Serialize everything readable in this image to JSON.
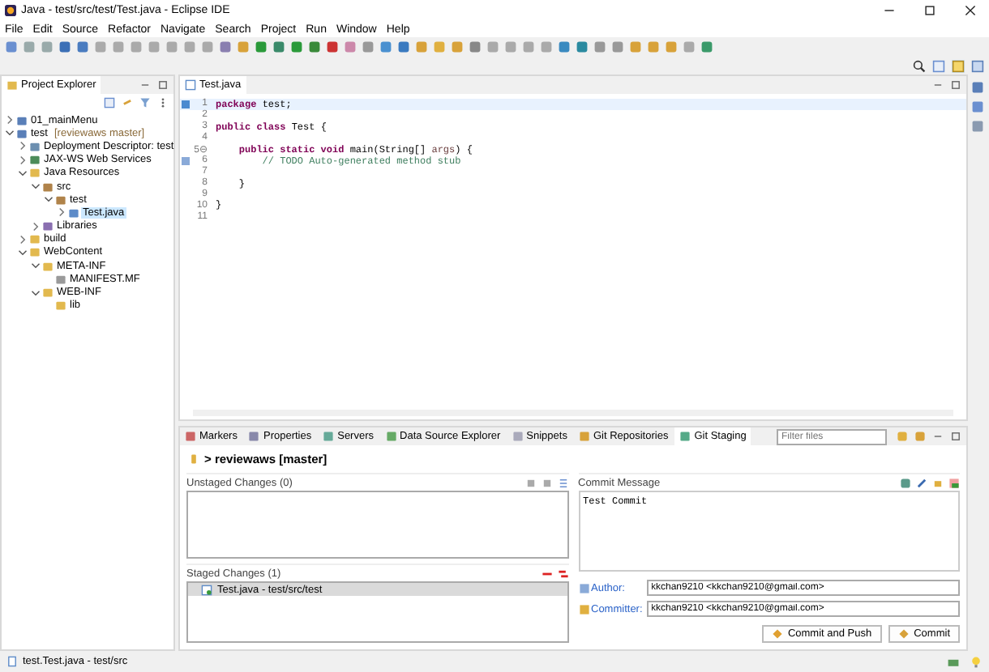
{
  "window": {
    "title": "Java - test/src/test/Test.java - Eclipse IDE"
  },
  "menu": [
    "File",
    "Edit",
    "Source",
    "Refactor",
    "Navigate",
    "Search",
    "Project",
    "Run",
    "Window",
    "Help"
  ],
  "project_explorer": {
    "tab": {
      "label": "Project Explorer",
      "selected": true
    },
    "tree": [
      {
        "label": "01_mainMenu",
        "expanded": false,
        "kind": "project"
      },
      {
        "label": "test",
        "decoration": "[reviewaws master]",
        "expanded": true,
        "kind": "project",
        "children": [
          {
            "label": "Deployment Descriptor: test",
            "expanded": false,
            "kind": "descriptor"
          },
          {
            "label": "JAX-WS Web Services",
            "expanded": false,
            "kind": "services"
          },
          {
            "label": "Java Resources",
            "expanded": true,
            "kind": "folder",
            "children": [
              {
                "label": "src",
                "expanded": true,
                "kind": "package",
                "children": [
                  {
                    "label": "test",
                    "expanded": true,
                    "kind": "package",
                    "children": [
                      {
                        "label": "Test.java",
                        "expanded": false,
                        "kind": "java",
                        "selected": true
                      }
                    ]
                  }
                ]
              },
              {
                "label": "Libraries",
                "expanded": false,
                "kind": "library"
              }
            ]
          },
          {
            "label": "build",
            "expanded": false,
            "kind": "folder"
          },
          {
            "label": "WebContent",
            "expanded": true,
            "kind": "folder",
            "children": [
              {
                "label": "META-INF",
                "expanded": true,
                "kind": "folder",
                "children": [
                  {
                    "label": "MANIFEST.MF",
                    "kind": "file"
                  }
                ]
              },
              {
                "label": "WEB-INF",
                "expanded": true,
                "kind": "folder",
                "children": [
                  {
                    "label": "lib",
                    "kind": "folder"
                  }
                ]
              }
            ]
          }
        ]
      }
    ]
  },
  "editor": {
    "tab": {
      "label": "Test.java",
      "selected": true
    },
    "lines": [
      {
        "number": "1",
        "tokens": [
          {
            "kind": "keyword",
            "text": "package"
          },
          {
            "kind": "plain",
            "text": " test;"
          }
        ]
      },
      {
        "number": "2"
      },
      {
        "number": "3",
        "tokens": [
          {
            "kind": "keyword",
            "text": "public class"
          },
          {
            "kind": "plain",
            "text": " Test {"
          }
        ]
      },
      {
        "number": "4"
      },
      {
        "number": "5⊖",
        "tokens": [
          {
            "kind": "keyword",
            "text": "    public static void"
          },
          {
            "kind": "plain",
            "text": " main(String[] "
          },
          {
            "kind": "param",
            "text": "args"
          },
          {
            "kind": "plain",
            "text": ") {"
          }
        ]
      },
      {
        "number": "6",
        "tokens": [
          {
            "kind": "comment",
            "text": "        // TODO Auto-generated method stub"
          }
        ]
      },
      {
        "number": "7"
      },
      {
        "number": "8",
        "tokens": [
          {
            "kind": "plain",
            "text": "    }"
          }
        ]
      },
      {
        "number": "9"
      },
      {
        "number": "10",
        "tokens": [
          {
            "kind": "plain",
            "text": "}"
          }
        ]
      },
      {
        "number": "11"
      }
    ]
  },
  "bottom_tabs": [
    {
      "label": "Markers",
      "selected": false
    },
    {
      "label": "Properties",
      "selected": false
    },
    {
      "label": "Servers",
      "selected": false
    },
    {
      "label": "Data Source Explorer",
      "selected": false
    },
    {
      "label": "Snippets",
      "selected": false
    },
    {
      "label": "Git Repositories",
      "selected": false
    },
    {
      "label": "Git Staging",
      "selected": true
    }
  ],
  "filter": {
    "placeholder": "Filter files"
  },
  "git_staging": {
    "repository": "> reviewaws [master]",
    "unstaged": {
      "title": "Unstaged Changes (0)"
    },
    "staged": {
      "title": "Staged Changes (1)",
      "items": [
        {
          "label": "Test.java - test/src/test",
          "selected": true
        }
      ]
    },
    "commit_message": {
      "title": "Commit Message",
      "value": "Test Commit"
    },
    "author": {
      "label": "Author:",
      "value": "kkchan9210 <kkchan9210@gmail.com>"
    },
    "committer": {
      "label": "Committer:",
      "value": "kkchan9210 <kkchan9210@gmail.com>"
    },
    "buttons": [
      "Commit and Push",
      "Commit"
    ]
  },
  "status_bar": {
    "text": "test.Test.java - test/src"
  }
}
